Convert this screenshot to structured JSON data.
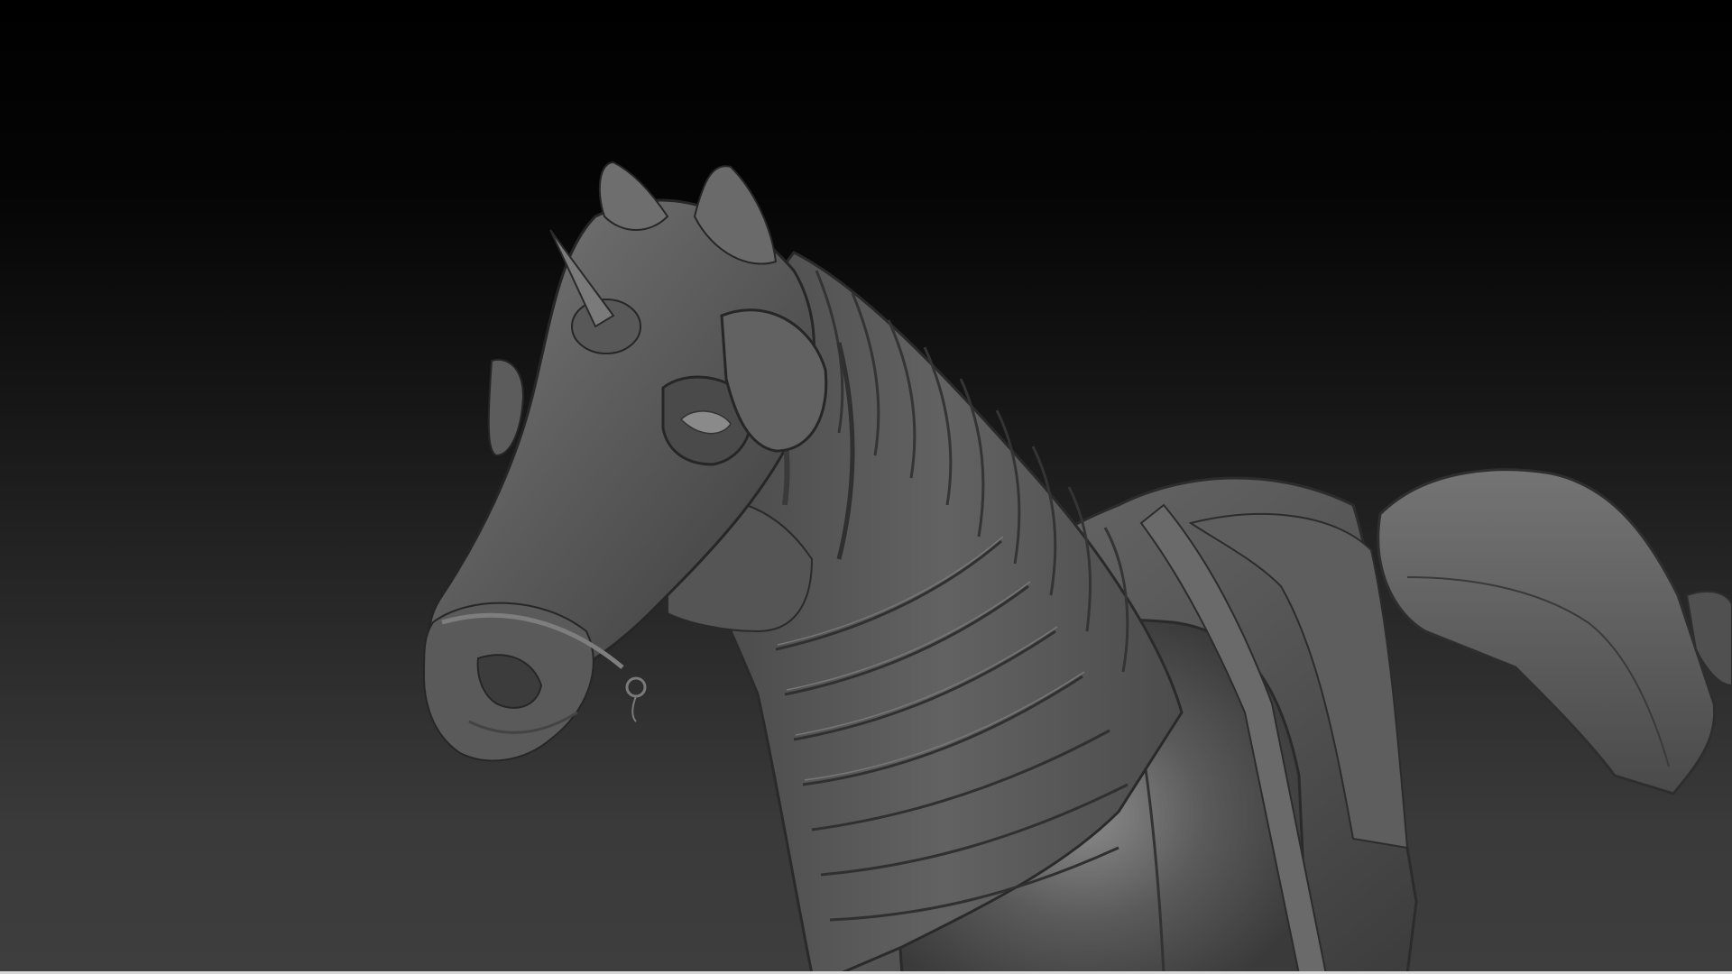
{
  "viewport": {
    "background_top_color": "#000000",
    "background_bottom_color": "#3e3e3e",
    "material_color": "#5a5a5a",
    "highlight_color": "#8a8a8a",
    "shadow_color": "#262626"
  },
  "subject": {
    "icon": "armored-horse-sculpt"
  }
}
